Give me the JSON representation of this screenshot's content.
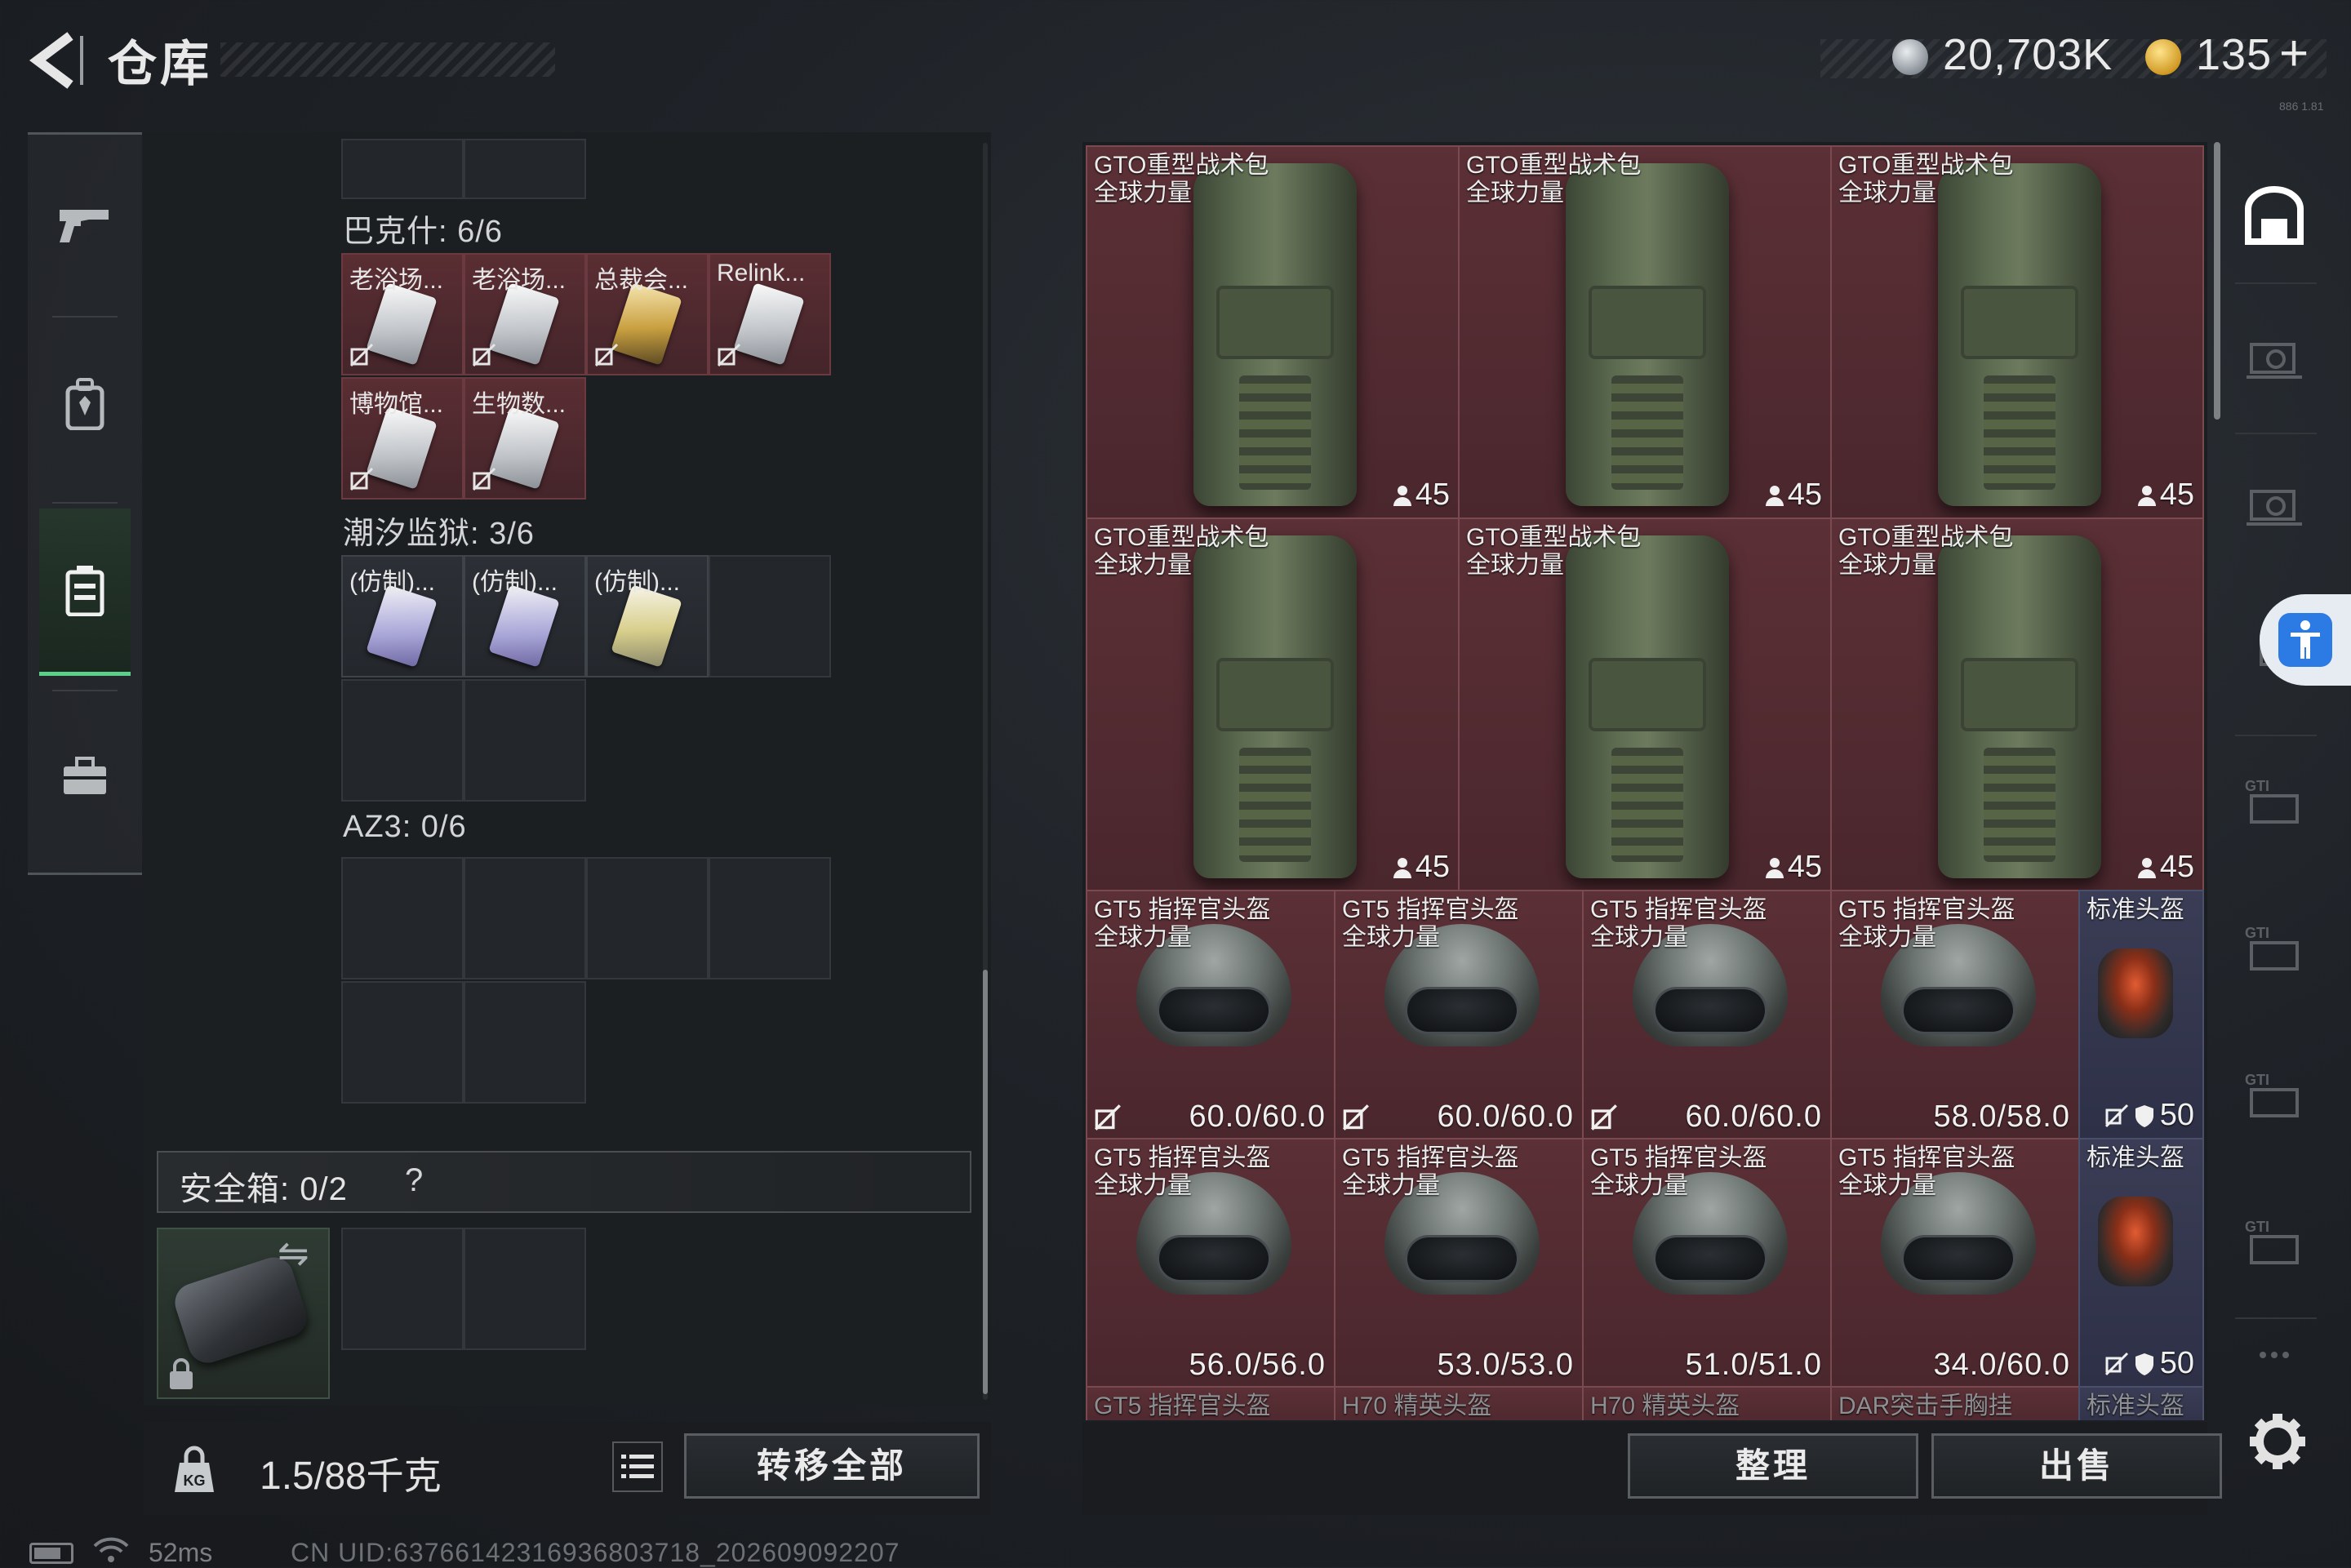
{
  "header": {
    "title": "仓库",
    "currency_silver": "20,703K",
    "currency_gold": "135",
    "gold_add": "+",
    "version_tiny": "886 1.81",
    "colors": {
      "accent_green": "#5ccf8a",
      "item_red": "#5b3036",
      "item_blue": "#3a3d55"
    }
  },
  "left_nav": {
    "items": [
      {
        "name": "weapon",
        "icon": "pistol-icon"
      },
      {
        "name": "equipment",
        "icon": "backpack-icon"
      },
      {
        "name": "stash",
        "icon": "stash-case-icon",
        "active": true
      },
      {
        "name": "toolbox",
        "icon": "toolbox-icon"
      }
    ]
  },
  "containers": {
    "bakeshi": {
      "label": "巴克什: 6/6",
      "items": [
        "老浴场...",
        "老浴场...",
        "总裁会...",
        "Relink...",
        "博物馆...",
        "生物数..."
      ]
    },
    "tide_prison": {
      "label": "潮汐监狱: 3/6",
      "items": [
        "(仿制)...",
        "(仿制)...",
        "(仿制)..."
      ]
    },
    "az3": {
      "label": "AZ3: 0/6"
    }
  },
  "safebox": {
    "label": "安全箱: 0/2",
    "help": "?",
    "swap_icon": "⇋"
  },
  "weight": {
    "current": "1.5",
    "max": "/88千克"
  },
  "buttons": {
    "transfer_all": "转移全部",
    "sort": "整理",
    "sell": "出售"
  },
  "stash": {
    "backpacks": [
      {
        "name": "GTO重型战术包",
        "tag": "全球力量",
        "count": "45"
      },
      {
        "name": "GTO重型战术包",
        "tag": "全球力量",
        "count": "45"
      },
      {
        "name": "GTO重型战术包",
        "tag": "全球力量",
        "count": "45"
      },
      {
        "name": "GTO重型战术包",
        "tag": "全球力量",
        "count": "45"
      },
      {
        "name": "GTO重型战术包",
        "tag": "全球力量",
        "count": "45"
      },
      {
        "name": "GTO重型战术包",
        "tag": "全球力量",
        "count": "45"
      }
    ],
    "helmets_row1": [
      {
        "name": "GT5 指挥官头盔",
        "tag": "全球力量",
        "durability": "60.0/60.0",
        "nodeal": true
      },
      {
        "name": "GT5 指挥官头盔",
        "tag": "全球力量",
        "durability": "60.0/60.0",
        "nodeal": true
      },
      {
        "name": "GT5 指挥官头盔",
        "tag": "全球力量",
        "durability": "60.0/60.0",
        "nodeal": true
      },
      {
        "name": "GT5 指挥官头盔",
        "tag": "全球力量",
        "durability": "58.0/58.0",
        "nodeal": false
      }
    ],
    "helmets_row2": [
      {
        "name": "GT5 指挥官头盔",
        "tag": "全球力量",
        "durability": "56.0/56.0"
      },
      {
        "name": "GT5 指挥官头盔",
        "tag": "全球力量",
        "durability": "53.0/53.0"
      },
      {
        "name": "GT5 指挥官头盔",
        "tag": "全球力量",
        "durability": "51.0/51.0"
      },
      {
        "name": "GT5 指挥官头盔",
        "tag": "全球力量",
        "durability": "34.0/60.0"
      }
    ],
    "standard_helmets": [
      {
        "name": "标准头盔",
        "value": "50"
      },
      {
        "name": "标准头盔",
        "value": "50"
      }
    ],
    "partial_row": [
      "GT5 指挥官头盔",
      "H70 精英头盔",
      "H70 精英头盔",
      "DAR突击手胸挂",
      "标准头盔"
    ]
  },
  "status": {
    "ping": "52ms",
    "uid": "CN UID:6376614231693680371​8_202609092207"
  }
}
